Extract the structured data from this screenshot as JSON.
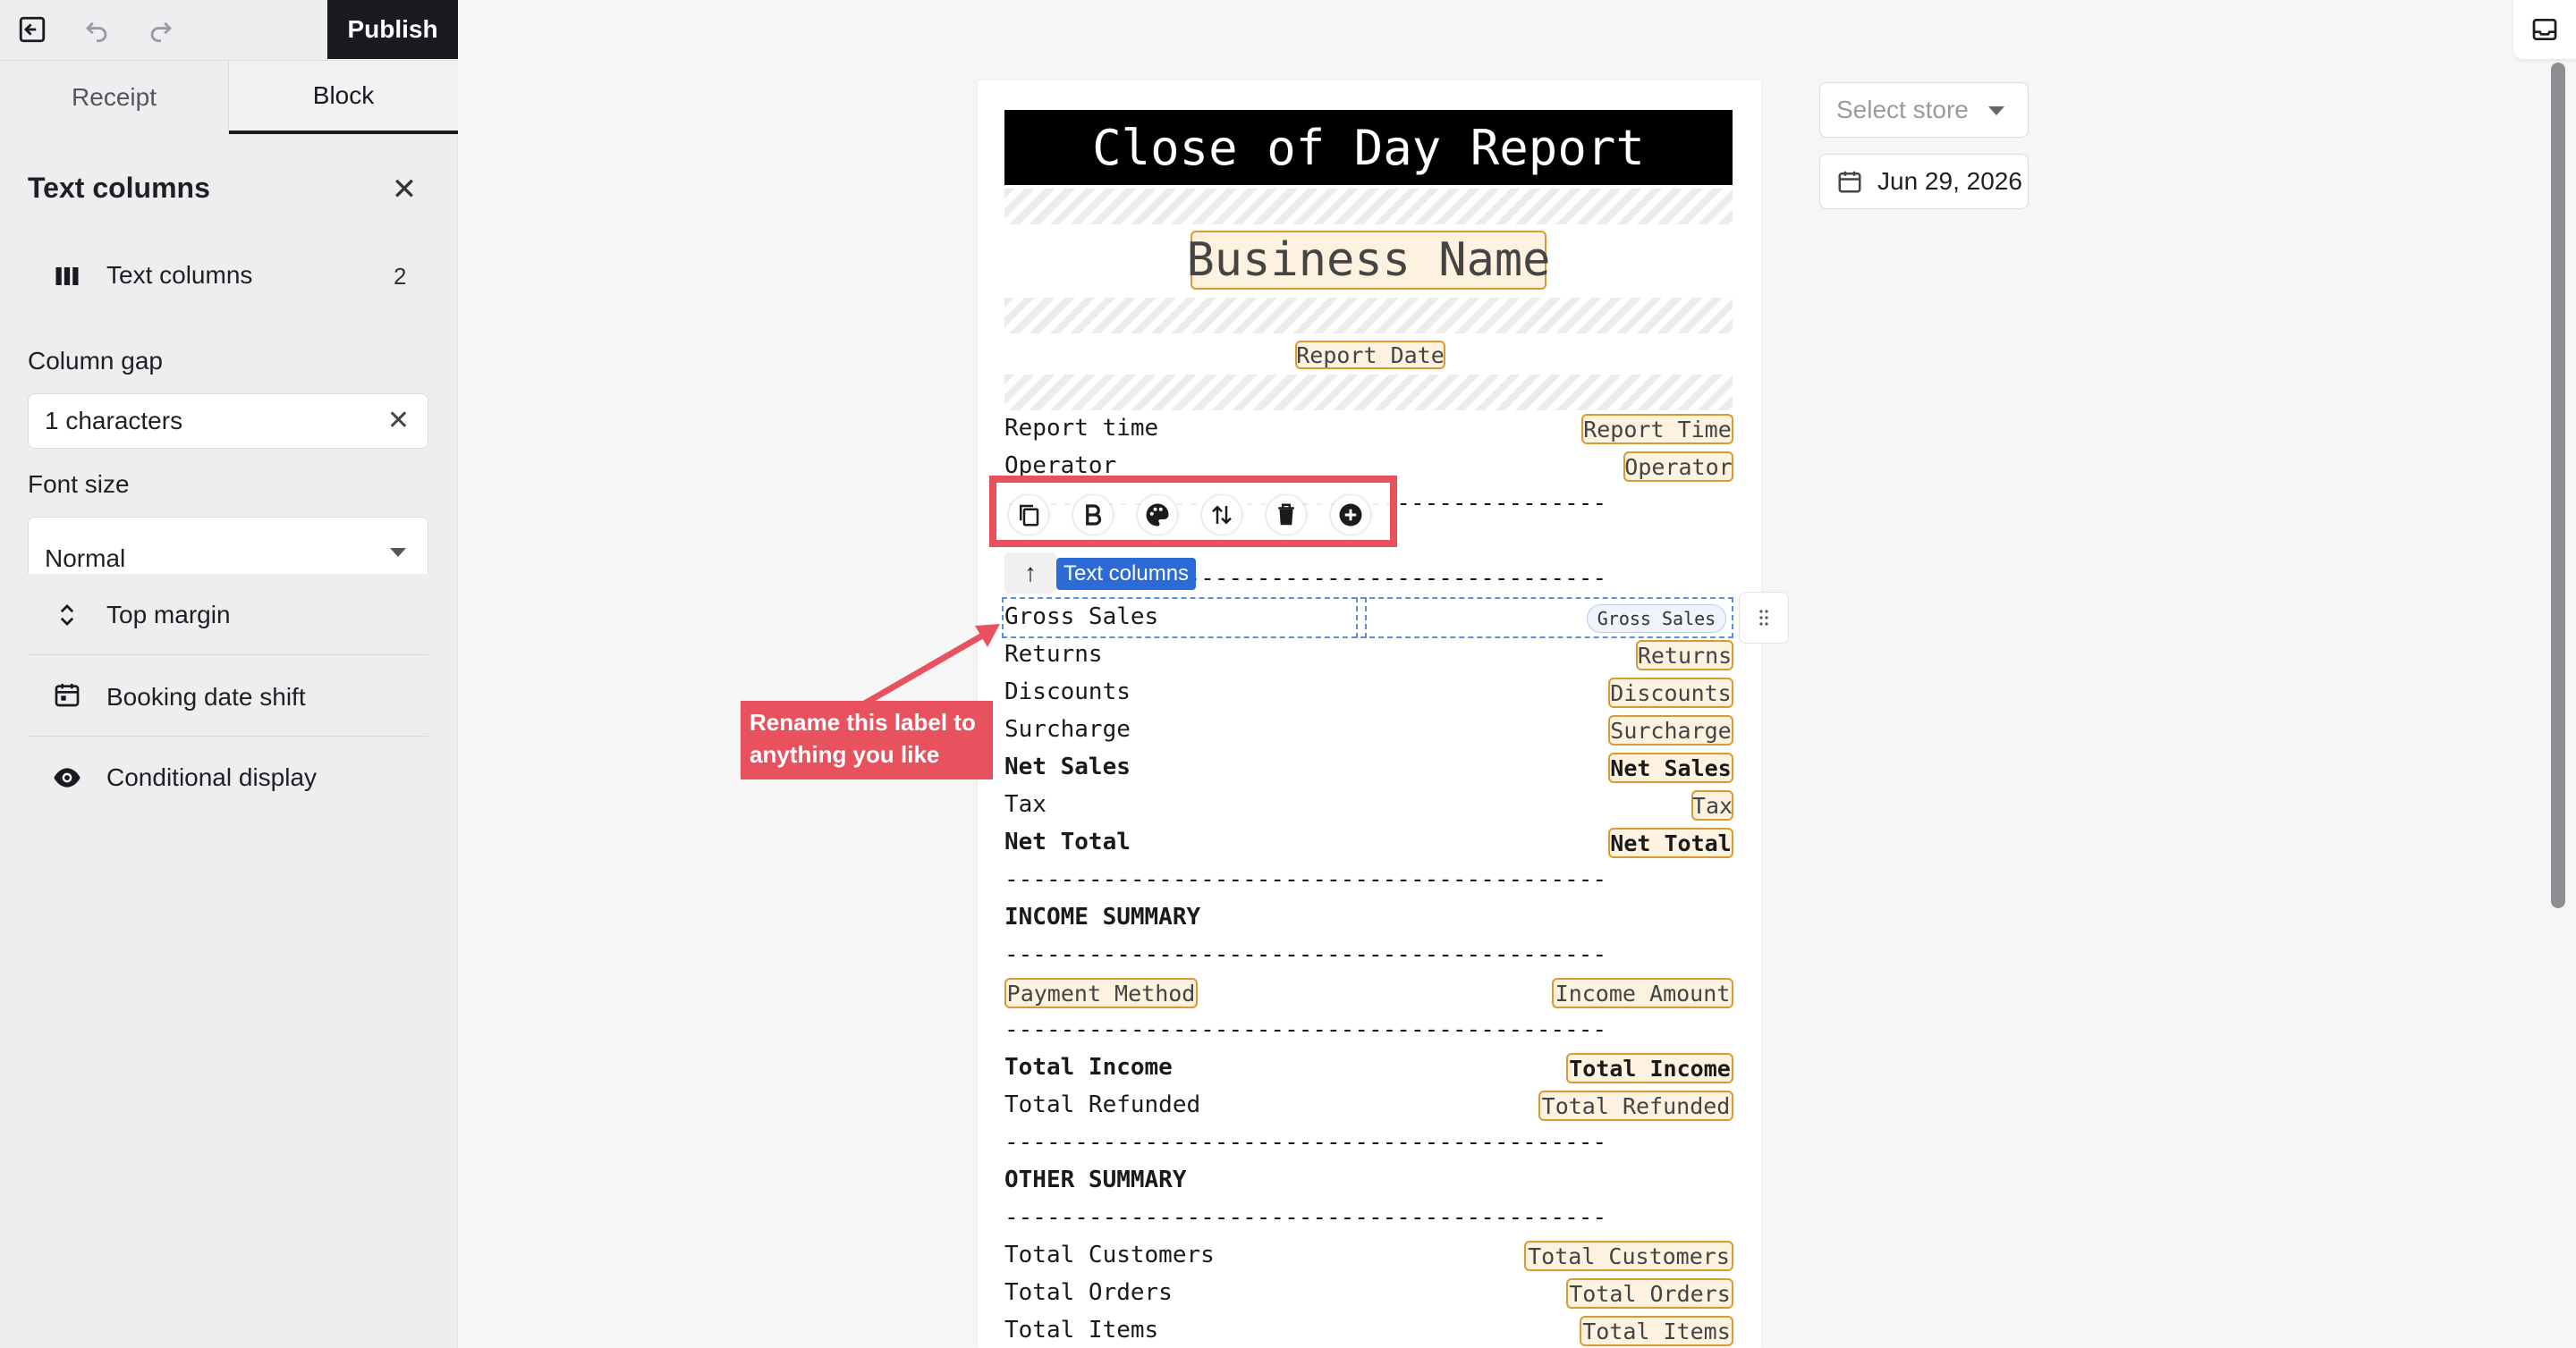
{
  "toolbar": {
    "publish_label": "Publish"
  },
  "tabs": [
    {
      "label": "Receipt"
    },
    {
      "label": "Block"
    }
  ],
  "panel": {
    "title": "Text columns",
    "columns_row": {
      "label": "Text columns",
      "count": "2"
    },
    "column_gap": {
      "label": "Column gap",
      "value": "1 characters"
    },
    "font_size": {
      "label": "Font size",
      "value": "Normal"
    },
    "options": [
      {
        "label": "Top margin",
        "icon": "vertical-expand-icon"
      },
      {
        "label": "Booking date shift",
        "icon": "calendar-icon"
      },
      {
        "label": "Conditional display",
        "icon": "eye-icon"
      }
    ]
  },
  "receipt": {
    "title": "Close of Day Report",
    "business_name": "Business Name",
    "report_date": "Report Date",
    "header_rows": [
      {
        "label": "Report time",
        "value": "Report Time"
      },
      {
        "label": "Operator",
        "value": "Operator"
      }
    ],
    "dashes": "-------------------------------------------",
    "sales_rows": [
      {
        "label": "Gross Sales",
        "value": "Gross Sales"
      },
      {
        "label": "Returns",
        "value": "Returns"
      },
      {
        "label": "Discounts",
        "value": "Discounts"
      },
      {
        "label": "Surcharge",
        "value": "Surcharge"
      },
      {
        "label": "Net Sales",
        "value": "Net Sales"
      },
      {
        "label": "Tax",
        "value": "Tax"
      },
      {
        "label": "Net Total",
        "value": "Net Total"
      }
    ],
    "income_heading": "INCOME SUMMARY",
    "income_cols": {
      "left": "Payment Method",
      "right": "Income Amount"
    },
    "income_rows": [
      {
        "label": "Total Income",
        "value": "Total Income"
      },
      {
        "label": "Total Refunded",
        "value": "Total Refunded"
      }
    ],
    "other_heading": "OTHER SUMMARY",
    "other_rows": [
      {
        "label": "Total Customers",
        "value": "Total Customers"
      },
      {
        "label": "Total Orders",
        "value": "Total Orders"
      },
      {
        "label": "Total Items",
        "value": "Total Items"
      }
    ]
  },
  "overlay": {
    "block_tag": "Text columns",
    "callout": "Rename this label to anything you like",
    "toolbar_icons": [
      "copy-icon",
      "bold-icon",
      "palette-icon",
      "swap-vertical-icon",
      "trash-icon",
      "add-circle-icon"
    ]
  },
  "controls": {
    "store_placeholder": "Select store",
    "date": "Jun 29, 2026"
  }
}
